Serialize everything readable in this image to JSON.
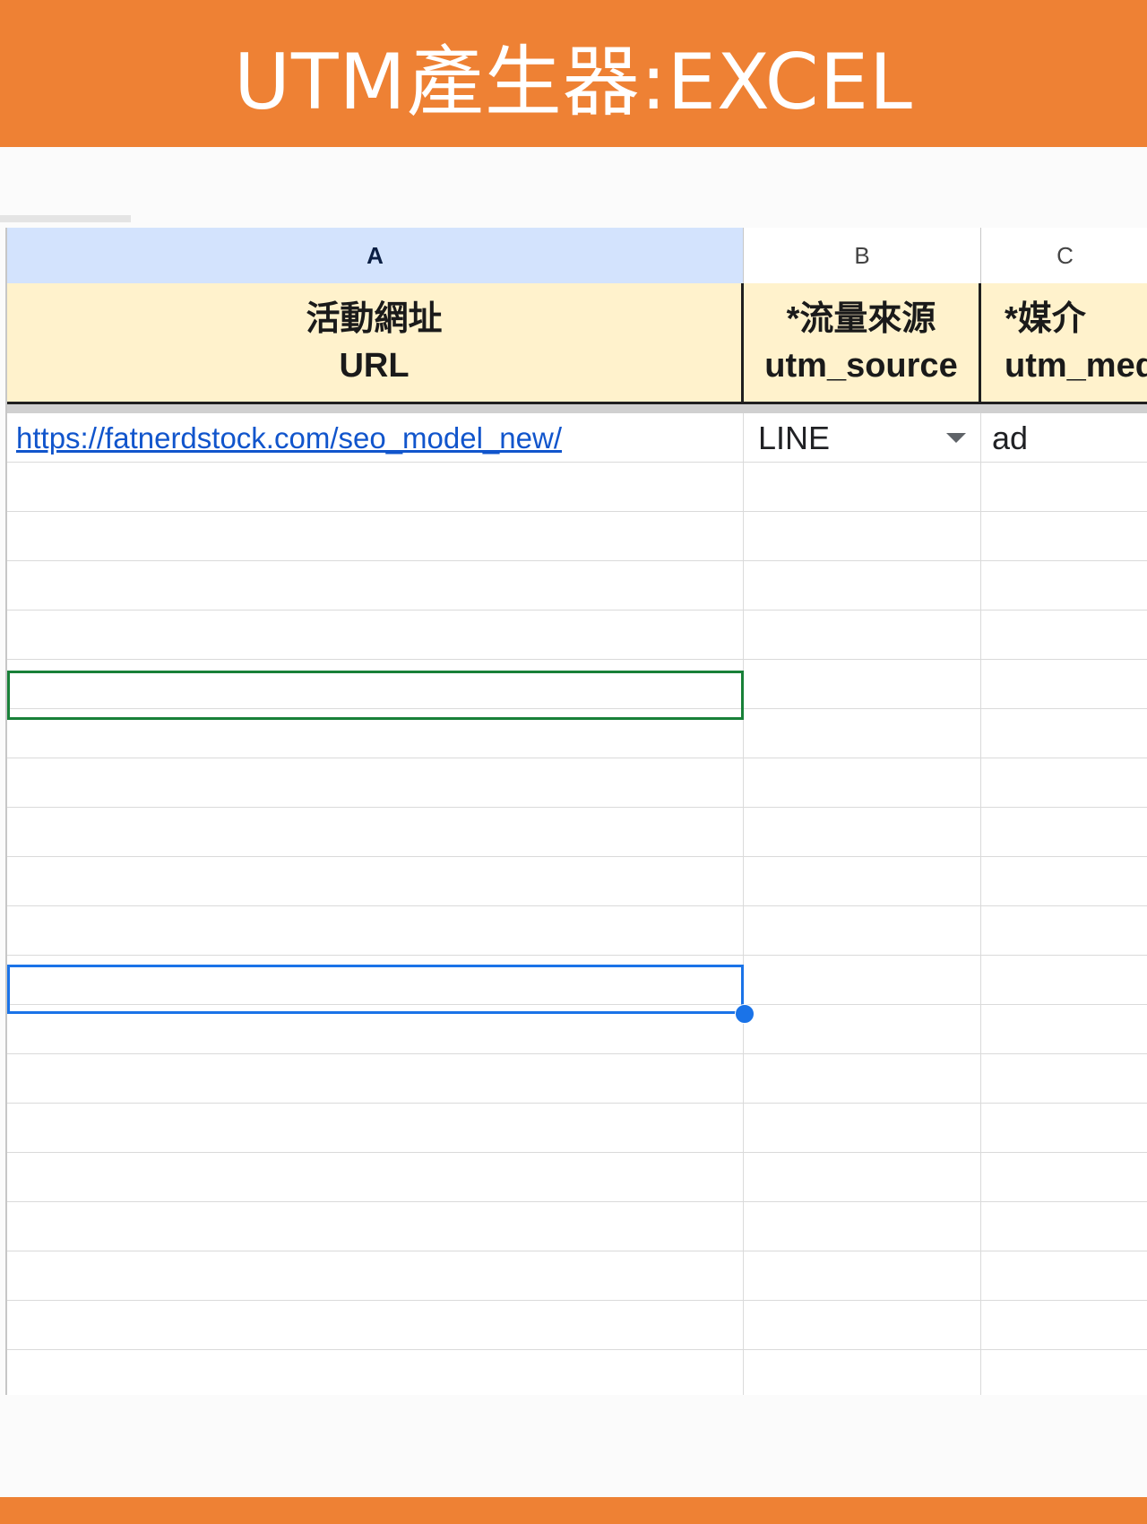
{
  "banner": {
    "title": "UTM產生器:EXCEL"
  },
  "sheet": {
    "column_letters": [
      "A",
      "B",
      "C"
    ],
    "selected_column": "A",
    "headers": [
      {
        "zh": "活動網址",
        "en": "URL"
      },
      {
        "zh": "*流量來源",
        "en": "utm_source"
      },
      {
        "zh": "*媒介",
        "en": "utm_medium"
      }
    ],
    "rows": [
      {
        "a": "https://fatnerdstock.com/seo_model_new/",
        "b": "LINE",
        "c": "ad"
      }
    ],
    "empty_rows": 19,
    "active_cell_row": 5,
    "range_selection_row": 11,
    "colors": {
      "banner": "#ee8134",
      "header_fill": "#fff2cc",
      "selected_column_fill": "#d3e3fd",
      "link": "#1155cc",
      "active_cell_border": "#188038",
      "selection_border": "#1a73e8"
    }
  }
}
